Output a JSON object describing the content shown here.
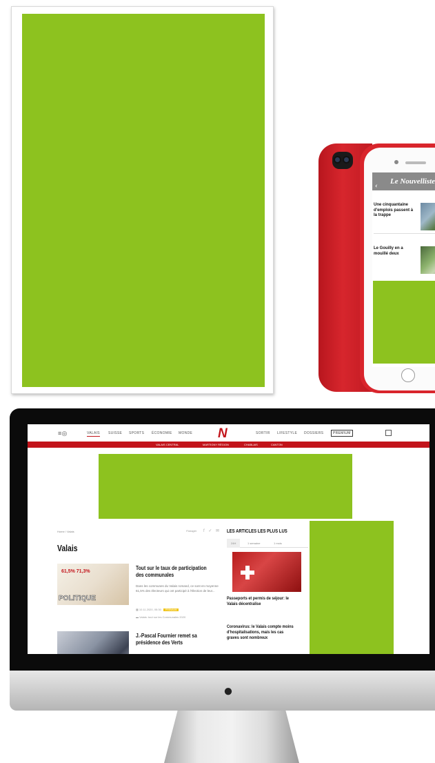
{
  "colors": {
    "ad_green": "#8dc21f",
    "brand_red": "#c2141b",
    "phone_red": "#d9252c"
  },
  "phone": {
    "app_title": "Le Nouvelliste",
    "back_icon": "chevron-left-icon",
    "articles": [
      {
        "title": "Une cinquantaine d'emplois passent à la trappe"
      },
      {
        "title": "Le Gouilly en a mouillé deux"
      }
    ]
  },
  "site": {
    "menu_icon": "hamburger-icon",
    "nav_left": [
      "VALAIS",
      "SUISSE",
      "SPORTS",
      "ÉCONOMIE",
      "MONDE"
    ],
    "logo": "N",
    "nav_right": [
      "SORTIR",
      "LIFESTYLE",
      "DOSSIERS"
    ],
    "premium": "PREMIUM",
    "subnav": [
      "VALAIS CENTRAL",
      "MARTIGNY RÉGION",
      "CHABLAIS",
      "CANTON"
    ],
    "breadcrumb": "Home / Valais",
    "share_label": "Partager",
    "share_icons": "f ✓ ✉",
    "page_title": "Valais",
    "articles": [
      {
        "title": "Tout sur le taux de participation des communales",
        "teaser": "Dans les communes du Valais romand, ce sont en moyenne 61,5% des électeurs qui ont participé à l'élection de leur...",
        "date": "10.11.2020, 05:30",
        "badge": "PREMIUM",
        "tag": "Valais: tout sur les Communales 2020",
        "image_text_1": "61,5%  71,3%",
        "image_text_2": "POLITIQUE"
      },
      {
        "title": "J.-Pascal Fournier remet sa présidence des Verts"
      }
    ],
    "sidebar": {
      "title": "LES ARTICLES LES PLUS LUS",
      "tabs": [
        "24H",
        "1 semaine",
        "1 mois"
      ],
      "items": [
        "Passeports et permis de séjour: le Valais décentralise",
        "Coronavirus: le Valais compte moins d'hospitalisations, mais les cas graves sont nombreux"
      ]
    }
  }
}
